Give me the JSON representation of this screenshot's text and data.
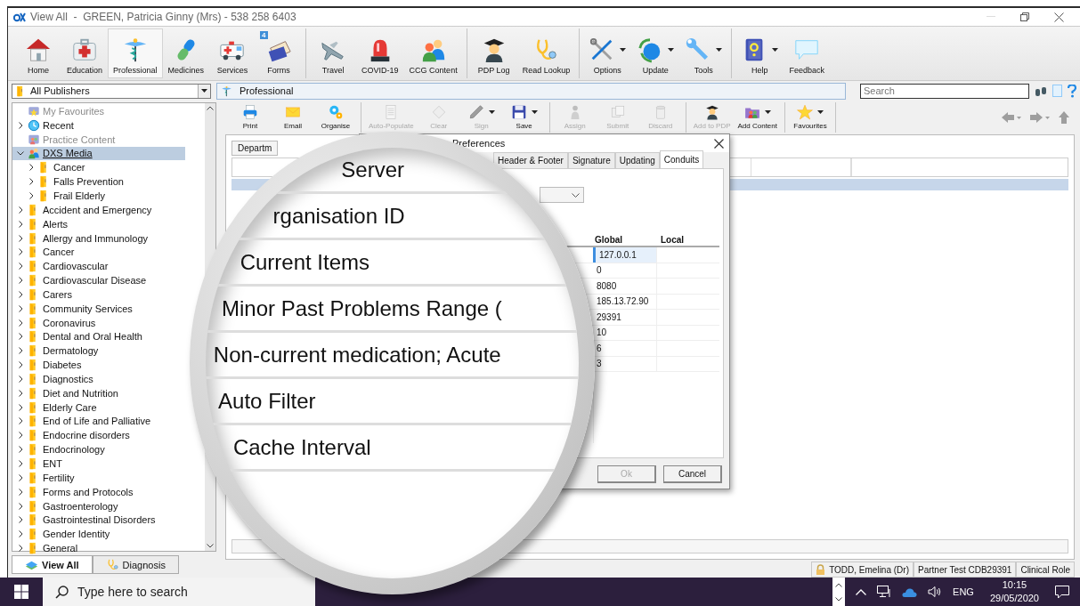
{
  "window": {
    "title": "View All  -  GREEN, Patricia Ginny (Mrs) - 538 258 6403"
  },
  "toolbar": {
    "groups": [
      [
        {
          "label": "Home",
          "kind": "home",
          "selected": false,
          "dropdown": false
        },
        {
          "label": "Education",
          "kind": "education",
          "selected": false,
          "dropdown": false
        },
        {
          "label": "Professional",
          "kind": "professional",
          "selected": true,
          "dropdown": false
        },
        {
          "label": "Medicines",
          "kind": "medicines",
          "selected": false,
          "dropdown": false
        },
        {
          "label": "Services",
          "kind": "services",
          "selected": false,
          "dropdown": false
        },
        {
          "label": "Forms",
          "kind": "forms",
          "selected": false,
          "dropdown": false,
          "badge": "4"
        }
      ],
      [
        {
          "label": "Travel",
          "kind": "travel",
          "selected": false,
          "dropdown": false
        },
        {
          "label": "COVID-19",
          "kind": "covid",
          "selected": false,
          "dropdown": false
        },
        {
          "label": "CCG Content",
          "kind": "ccg",
          "selected": false,
          "dropdown": false
        }
      ],
      [
        {
          "label": "PDP Log",
          "kind": "pdp",
          "selected": false,
          "dropdown": false
        },
        {
          "label": "Read Lookup",
          "kind": "lookup",
          "selected": false,
          "dropdown": false
        }
      ],
      [
        {
          "label": "Options",
          "kind": "options",
          "selected": false,
          "dropdown": true
        },
        {
          "label": "Update",
          "kind": "update",
          "selected": false,
          "dropdown": true
        },
        {
          "label": "Tools",
          "kind": "tools",
          "selected": false,
          "dropdown": true
        }
      ],
      [
        {
          "label": "Help",
          "kind": "help",
          "selected": false,
          "dropdown": true
        },
        {
          "label": "Feedback",
          "kind": "feedback",
          "selected": false,
          "dropdown": false
        }
      ]
    ]
  },
  "publisher_select": {
    "value": "All Publishers"
  },
  "breadcrumb": {
    "label": "Professional"
  },
  "search": {
    "placeholder": "Search"
  },
  "tree": {
    "items": [
      {
        "label": "My Favourites",
        "kind": "favourites",
        "disabled": true,
        "selected": false
      },
      {
        "label": "Recent",
        "kind": "recent",
        "disabled": false,
        "selected": false,
        "expanded": false
      },
      {
        "label": "Practice Content",
        "kind": "practice",
        "disabled": true,
        "selected": false
      },
      {
        "label": "DXS Media",
        "kind": "publisher",
        "disabled": false,
        "selected": true,
        "expanded": true,
        "children": [
          {
            "label": "Cancer",
            "kind": "folder",
            "disabled": false,
            "selected": false,
            "expanded": false
          },
          {
            "label": "Falls Prevention",
            "kind": "folder",
            "disabled": false,
            "selected": false,
            "expanded": false
          },
          {
            "label": "Frail Elderly",
            "kind": "folder",
            "disabled": false,
            "selected": false,
            "expanded": false
          }
        ]
      },
      {
        "label": "Accident and Emergency",
        "kind": "folder",
        "disabled": false,
        "selected": false,
        "expanded": false
      },
      {
        "label": "Alerts",
        "kind": "folder",
        "disabled": false,
        "selected": false,
        "expanded": false
      },
      {
        "label": "Allergy and Immunology",
        "kind": "folder",
        "disabled": false,
        "selected": false,
        "expanded": false
      },
      {
        "label": "Cancer",
        "kind": "folder",
        "disabled": false,
        "selected": false,
        "expanded": false
      },
      {
        "label": "Cardiovascular",
        "kind": "folder",
        "disabled": false,
        "selected": false,
        "expanded": false
      },
      {
        "label": "Cardiovascular Disease",
        "kind": "folder",
        "disabled": false,
        "selected": false,
        "expanded": false
      },
      {
        "label": "Carers",
        "kind": "folder",
        "disabled": false,
        "selected": false,
        "expanded": false
      },
      {
        "label": "Community Services",
        "kind": "folder",
        "disabled": false,
        "selected": false,
        "expanded": false
      },
      {
        "label": "Coronavirus",
        "kind": "folder",
        "disabled": false,
        "selected": false,
        "expanded": false
      },
      {
        "label": "Dental and Oral Health",
        "kind": "folder",
        "disabled": false,
        "selected": false,
        "expanded": false
      },
      {
        "label": "Dermatology",
        "kind": "folder",
        "disabled": false,
        "selected": false,
        "expanded": false
      },
      {
        "label": "Diabetes",
        "kind": "folder",
        "disabled": false,
        "selected": false,
        "expanded": false
      },
      {
        "label": "Diagnostics",
        "kind": "folder",
        "disabled": false,
        "selected": false,
        "expanded": false
      },
      {
        "label": "Diet and Nutrition",
        "kind": "folder",
        "disabled": false,
        "selected": false,
        "expanded": false
      },
      {
        "label": "Elderly Care",
        "kind": "folder",
        "disabled": false,
        "selected": false,
        "expanded": false
      },
      {
        "label": "End of Life and Palliative",
        "kind": "folder",
        "disabled": false,
        "selected": false,
        "expanded": false
      },
      {
        "label": "Endocrine disorders",
        "kind": "folder",
        "disabled": false,
        "selected": false,
        "expanded": false
      },
      {
        "label": "Endocrinology",
        "kind": "folder",
        "disabled": false,
        "selected": false,
        "expanded": false
      },
      {
        "label": "ENT",
        "kind": "folder",
        "disabled": false,
        "selected": false,
        "expanded": false
      },
      {
        "label": "Fertility",
        "kind": "folder",
        "disabled": false,
        "selected": false,
        "expanded": false
      },
      {
        "label": "Forms and Protocols",
        "kind": "folder",
        "disabled": false,
        "selected": false,
        "expanded": false
      },
      {
        "label": "Gastroenterology",
        "kind": "folder",
        "disabled": false,
        "selected": false,
        "expanded": false
      },
      {
        "label": "Gastrointestinal Disorders",
        "kind": "folder",
        "disabled": false,
        "selected": false,
        "expanded": false
      },
      {
        "label": "Gender Identity",
        "kind": "folder",
        "disabled": false,
        "selected": false,
        "expanded": false
      },
      {
        "label": "General",
        "kind": "folder",
        "disabled": false,
        "selected": false,
        "expanded": false
      }
    ]
  },
  "bottom_tabs": [
    {
      "label": "View All",
      "kind": "books",
      "selected": true
    },
    {
      "label": "Diagnosis",
      "kind": "stethoscope",
      "selected": false
    }
  ],
  "content_toolbar": {
    "groups": [
      [
        {
          "label": "Print",
          "kind": "print",
          "disabled": false,
          "dropdown": false
        },
        {
          "label": "Email",
          "kind": "email",
          "disabled": false,
          "dropdown": false
        },
        {
          "label": "Organise",
          "kind": "organise",
          "disabled": false,
          "dropdown": false
        }
      ],
      [
        {
          "label": "Auto-Populate",
          "kind": "autopopulate",
          "disabled": true,
          "dropdown": false
        },
        {
          "label": "Clear",
          "kind": "clear",
          "disabled": true,
          "dropdown": false
        },
        {
          "label": "Sign",
          "kind": "sign",
          "disabled": true,
          "dropdown": true
        },
        {
          "label": "Save",
          "kind": "save",
          "disabled": false,
          "dropdown": true
        }
      ],
      [
        {
          "label": "Assign",
          "kind": "assign",
          "disabled": true,
          "dropdown": false
        },
        {
          "label": "Submit",
          "kind": "submit",
          "disabled": true,
          "dropdown": false
        },
        {
          "label": "Discard",
          "kind": "discard",
          "disabled": true,
          "dropdown": false
        }
      ],
      [
        {
          "label": "Add to PDP",
          "kind": "addpdp",
          "disabled": true,
          "dropdown": false
        },
        {
          "label": "Add Content",
          "kind": "addcontent",
          "disabled": false,
          "dropdown": true
        }
      ],
      [
        {
          "label": "Favourites",
          "kind": "favourites",
          "disabled": false,
          "dropdown": true
        }
      ]
    ]
  },
  "content": {
    "tab": "Departm"
  },
  "dialog": {
    "title": "Preferences",
    "tabs": [
      {
        "label": "Header & Footer",
        "selected": false
      },
      {
        "label": "Signature",
        "selected": false
      },
      {
        "label": "Updating",
        "selected": false
      },
      {
        "label": "Conduits",
        "selected": true
      }
    ],
    "grid": {
      "columns": [
        "Global",
        "Local"
      ],
      "rows": [
        {
          "global": "127.0.0.1",
          "selected": true
        },
        {
          "global": "0",
          "selected": false
        },
        {
          "global": "8080",
          "selected": false
        },
        {
          "global": "185.13.72.90",
          "selected": false
        },
        {
          "global": "29391",
          "selected": false
        },
        {
          "global": "10",
          "selected": false
        },
        {
          "global": "6",
          "selected": false
        },
        {
          "global": "3",
          "selected": false
        }
      ]
    },
    "buttons": [
      {
        "label": "Ok",
        "disabled": true
      },
      {
        "label": "Cancel",
        "disabled": false
      }
    ]
  },
  "magnifier": {
    "rows": [
      "Server",
      "rganisation ID",
      "Current Items",
      "Minor Past Problems Range (",
      "Non-current medication; Acute",
      "Auto Filter",
      "Cache Interval"
    ]
  },
  "status_bar": {
    "cells": [
      "TODD, Emelina (Dr)",
      "Partner Test CDB29391",
      "Clinical Role"
    ]
  },
  "taskbar": {
    "search_placeholder": "Type here to search",
    "language": "ENG",
    "time": "10:15",
    "date": "29/05/2020"
  }
}
